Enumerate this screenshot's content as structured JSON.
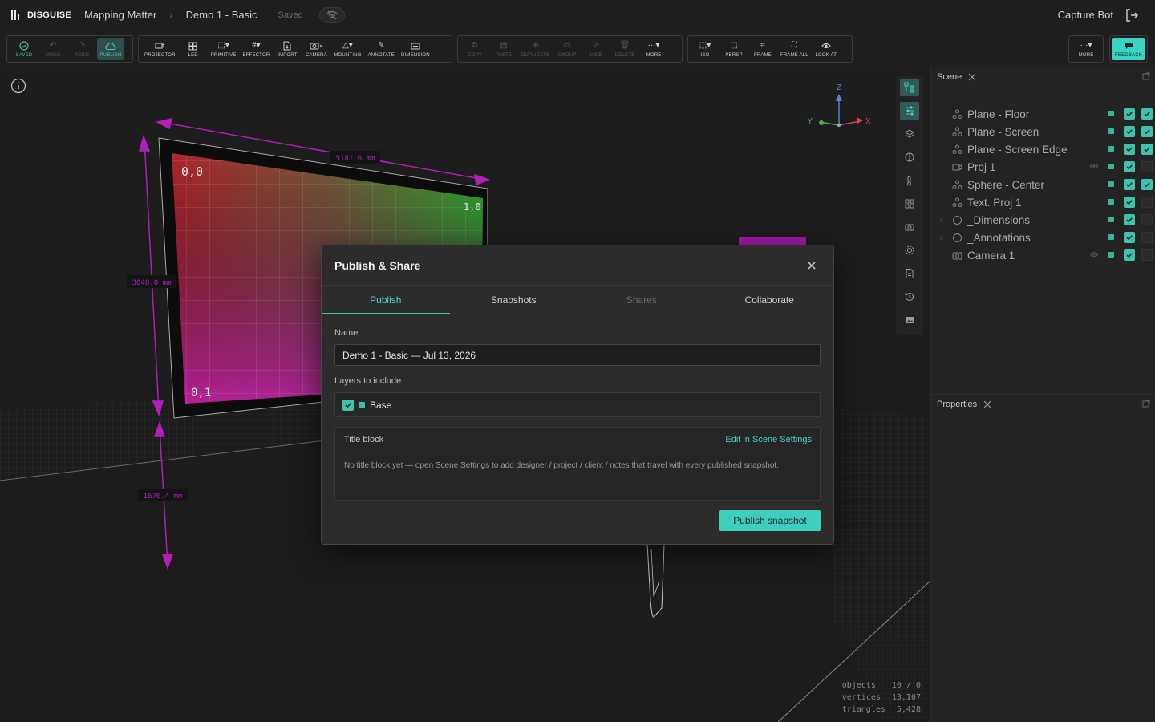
{
  "app": {
    "brand": "DISGUISE",
    "breadcrumb_project": "Mapping Matter",
    "breadcrumb_scene": "Demo 1 - Basic",
    "save_status": "Saved",
    "user_name": "Capture Bot"
  },
  "toolbar": {
    "history": [
      {
        "label": "SAVED",
        "icon": "check-circle-icon"
      },
      {
        "label": "UNDO",
        "icon": "undo-icon"
      },
      {
        "label": "REDO",
        "icon": "redo-icon"
      },
      {
        "label": "PUBLISH",
        "icon": "cloud-upload-icon"
      }
    ],
    "create": [
      {
        "label": "PROJECTOR",
        "icon": "projector-icon"
      },
      {
        "label": "LED",
        "icon": "led-grid-icon"
      },
      {
        "label": "PRIMITIVE",
        "icon": "primitive-icon"
      },
      {
        "label": "EFFECTOR",
        "icon": "effector-grid-icon"
      },
      {
        "label": "IMPORT",
        "icon": "import-file-icon"
      },
      {
        "label": "CAMERA",
        "icon": "camera-icon"
      },
      {
        "label": "MOUNTING",
        "icon": "mounting-icon"
      },
      {
        "label": "ANNOTATE",
        "icon": "pencil-icon"
      },
      {
        "label": "DIMENSION",
        "icon": "dimension-icon"
      }
    ],
    "edit": [
      {
        "label": "COPY",
        "icon": "copy-icon"
      },
      {
        "label": "PASTE",
        "icon": "paste-icon"
      },
      {
        "label": "DUPLICATE",
        "icon": "duplicate-icon"
      },
      {
        "label": "GROUP",
        "icon": "folder-icon"
      },
      {
        "label": "HIDE",
        "icon": "eye-off-icon"
      },
      {
        "label": "DELETE",
        "icon": "trash-icon"
      },
      {
        "label": "MORE",
        "icon": "more-icon"
      }
    ],
    "view": [
      {
        "label": "ISO",
        "icon": "iso-view-icon"
      },
      {
        "label": "PERSP",
        "icon": "perspective-icon"
      },
      {
        "label": "FRAME",
        "icon": "frame-icon"
      },
      {
        "label": "FRAME ALL",
        "icon": "frame-all-icon"
      },
      {
        "label": "LOOK AT",
        "icon": "eye-icon"
      }
    ],
    "more_label": "MORE",
    "feedback_label": "FEEDBACK"
  },
  "viewport": {
    "dimension_width": "5181.6 mm",
    "dimension_height": "3048.0 mm",
    "dimension_elevation": "1676.4 mm",
    "axis_z": "Z",
    "axis_x": "X",
    "axis_y": "Y",
    "stats": [
      {
        "label": "objects",
        "value": "10 / 0"
      },
      {
        "label": "vertices",
        "value": "13,107"
      },
      {
        "label": "triangles",
        "value": "5,428"
      }
    ]
  },
  "scene_panel": {
    "title": "Scene",
    "items": [
      {
        "name": "Plane - Floor",
        "icon": "mesh-icon",
        "expandable": false,
        "eye": false,
        "visible": true,
        "locked": true
      },
      {
        "name": "Plane - Screen",
        "icon": "mesh-icon",
        "expandable": false,
        "eye": false,
        "visible": true,
        "locked": true
      },
      {
        "name": "Plane - Screen Edge",
        "icon": "mesh-icon",
        "expandable": false,
        "eye": false,
        "visible": true,
        "locked": true
      },
      {
        "name": "Proj 1",
        "icon": "projector-icon",
        "expandable": false,
        "eye": true,
        "visible": true,
        "locked": false
      },
      {
        "name": "Sphere - Center",
        "icon": "mesh-icon",
        "expandable": false,
        "eye": false,
        "visible": true,
        "locked": true
      },
      {
        "name": "Text. Proj 1",
        "icon": "mesh-icon",
        "expandable": false,
        "eye": false,
        "visible": true,
        "locked": false
      },
      {
        "name": "_Dimensions",
        "icon": "group-icon",
        "expandable": true,
        "eye": false,
        "visible": true,
        "locked": false
      },
      {
        "name": "_Annotations",
        "icon": "group-icon",
        "expandable": true,
        "eye": false,
        "visible": true,
        "locked": false
      },
      {
        "name": "Camera 1",
        "icon": "camera-icon",
        "expandable": false,
        "eye": true,
        "visible": true,
        "locked": false
      }
    ]
  },
  "properties_panel": {
    "title": "Properties"
  },
  "modal": {
    "title": "Publish & Share",
    "tabs": [
      {
        "label": "Publish",
        "state": "active"
      },
      {
        "label": "Snapshots",
        "state": "normal"
      },
      {
        "label": "Shares",
        "state": "disabled"
      },
      {
        "label": "Collaborate",
        "state": "normal"
      }
    ],
    "name_label": "Name",
    "name_value": "Demo 1 - Basic — Jul 13, 2026",
    "layers_label": "Layers to include",
    "layer_name": "Base",
    "layer_checked": true,
    "title_block_label": "Title block",
    "title_block_link": "Edit in Scene Settings",
    "title_block_text": "No title block yet — open Scene Settings to add designer / project / client / notes that travel with every published snapshot.",
    "publish_button": "Publish snapshot"
  },
  "colors": {
    "accent": "#3fc1ad",
    "dimension": "#b21fb8",
    "background": "#1b1b1b"
  }
}
